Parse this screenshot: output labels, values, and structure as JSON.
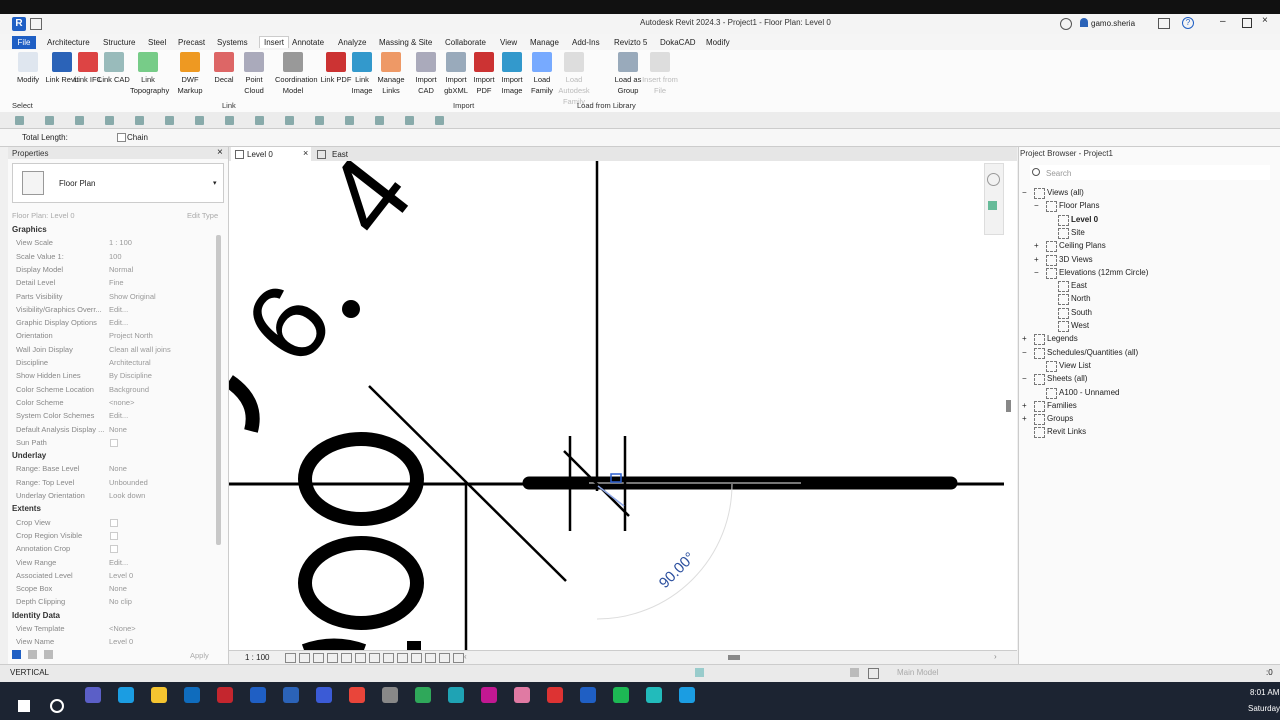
{
  "title_bar": {
    "title": "Autodesk Revit 2024.3 - Project1 - Floor Plan: Level 0",
    "user": "gamo.sheria",
    "logo_letter": "R"
  },
  "menu_tabs": [
    "File",
    "Architecture",
    "Structure",
    "Steel",
    "Precast",
    "Systems",
    "Insert",
    "Annotate",
    "Analyze",
    "Massing & Site",
    "Collaborate",
    "View",
    "Manage",
    "Add-Ins",
    "Revizto 5",
    "DokaCAD",
    "Modify"
  ],
  "active_tab": "Insert",
  "ribbon": {
    "buttons": [
      {
        "label": "Modify",
        "color": "#dfe6ef"
      },
      {
        "label": "Link Revit",
        "color": "#2b63b8"
      },
      {
        "label": "Link IFC",
        "color": "#d44"
      },
      {
        "label": "Link CAD",
        "color": "#9bb"
      },
      {
        "label": "Link Topography",
        "color": "#7c8"
      },
      {
        "label": "DWF Markup",
        "color": "#e92"
      },
      {
        "label": "Decal",
        "color": "#d66"
      },
      {
        "label": "Point Cloud",
        "color": "#aab"
      },
      {
        "label": "Coordination Model",
        "color": "#999"
      },
      {
        "label": "Link PDF",
        "color": "#c33"
      },
      {
        "label": "Link Image",
        "color": "#39c"
      },
      {
        "label": "Manage Links",
        "color": "#e96"
      },
      {
        "label": "Import CAD",
        "color": "#aab"
      },
      {
        "label": "Import gbXML",
        "color": "#9ab"
      },
      {
        "label": "Import PDF",
        "color": "#c33"
      },
      {
        "label": "Import Image",
        "color": "#39c"
      },
      {
        "label": "Load Family",
        "color": "#7af"
      },
      {
        "label": "Load Autodesk Family",
        "color": "#ddd"
      },
      {
        "label": "Load as Group",
        "color": "#9ab"
      },
      {
        "label": "Insert from File",
        "color": "#ddd"
      }
    ],
    "groups": {
      "select": "Select",
      "link": "Link",
      "import": "Import",
      "library": "Load from Library"
    }
  },
  "options_bar": {
    "total_length": "Total Length:",
    "chain": "Chain"
  },
  "properties": {
    "header": "Properties",
    "type_name": "Floor Plan",
    "instance": "Floor Plan: Level 0",
    "edit_type": "Edit Type",
    "sections": [
      {
        "title": "Graphics",
        "rows": [
          [
            "View Scale",
            "1 : 100"
          ],
          [
            "Scale Value    1:",
            "100"
          ],
          [
            "Display Model",
            "Normal"
          ],
          [
            "Detail Level",
            "Fine"
          ],
          [
            "Parts Visibility",
            "Show Original"
          ],
          [
            "Visibility/Graphics Overr...",
            "Edit..."
          ],
          [
            "Graphic Display Options",
            "Edit..."
          ],
          [
            "Orientation",
            "Project North"
          ],
          [
            "Wall Join Display",
            "Clean all wall joins"
          ],
          [
            "Discipline",
            "Architectural"
          ],
          [
            "Show Hidden Lines",
            "By Discipline"
          ],
          [
            "Color Scheme Location",
            "Background"
          ],
          [
            "Color Scheme",
            "<none>"
          ],
          [
            "System Color Schemes",
            "Edit..."
          ],
          [
            "Default Analysis Display ...",
            "None"
          ],
          [
            "Sun Path",
            ""
          ]
        ]
      },
      {
        "title": "Underlay",
        "rows": [
          [
            "Range: Base Level",
            "None"
          ],
          [
            "Range: Top Level",
            "Unbounded"
          ],
          [
            "Underlay Orientation",
            "Look down"
          ]
        ]
      },
      {
        "title": "Extents",
        "rows": [
          [
            "Crop View",
            ""
          ],
          [
            "Crop Region Visible",
            ""
          ],
          [
            "Annotation Crop",
            ""
          ],
          [
            "View Range",
            "Edit..."
          ],
          [
            "Associated Level",
            "Level 0"
          ],
          [
            "Scope Box",
            "None"
          ],
          [
            "Depth Clipping",
            "No clip"
          ]
        ]
      },
      {
        "title": "Identity Data",
        "rows": [
          [
            "View Template",
            "<None>"
          ],
          [
            "View Name",
            "Level 0"
          ]
        ]
      }
    ],
    "apply": "Apply"
  },
  "view_tabs": [
    "Level 0",
    "East"
  ],
  "canvas": {
    "dimension_digits": [
      "4",
      "6",
      "0",
      "0"
    ],
    "angle_label": "90.00°"
  },
  "view_control": {
    "scale": "1 : 100"
  },
  "project_browser": {
    "header": "Project Browser - Project1",
    "search_placeholder": "Search",
    "items": [
      {
        "label": "Views (all)",
        "depth": 0,
        "toggle": "−"
      },
      {
        "label": "Floor Plans",
        "depth": 1,
        "toggle": "−"
      },
      {
        "label": "Level 0",
        "depth": 2,
        "toggle": ""
      },
      {
        "label": "Site",
        "depth": 2,
        "toggle": ""
      },
      {
        "label": "Ceiling Plans",
        "depth": 1,
        "toggle": "+"
      },
      {
        "label": "3D Views",
        "depth": 1,
        "toggle": "+"
      },
      {
        "label": "Elevations (12mm Circle)",
        "depth": 1,
        "toggle": "−"
      },
      {
        "label": "East",
        "depth": 2,
        "toggle": ""
      },
      {
        "label": "North",
        "depth": 2,
        "toggle": ""
      },
      {
        "label": "South",
        "depth": 2,
        "toggle": ""
      },
      {
        "label": "West",
        "depth": 2,
        "toggle": ""
      },
      {
        "label": "Legends",
        "depth": 0,
        "toggle": "+"
      },
      {
        "label": "Schedules/Quantities (all)",
        "depth": 0,
        "toggle": "−"
      },
      {
        "label": "View List",
        "depth": 1,
        "toggle": ""
      },
      {
        "label": "Sheets (all)",
        "depth": 0,
        "toggle": "−"
      },
      {
        "label": "A100 - Unnamed",
        "depth": 1,
        "toggle": ""
      },
      {
        "label": "Families",
        "depth": 0,
        "toggle": "+"
      },
      {
        "label": "Groups",
        "depth": 0,
        "toggle": "+"
      },
      {
        "label": "Revit Links",
        "depth": 0,
        "toggle": ""
      }
    ]
  },
  "status_bar": {
    "left": "VERTICAL",
    "model": "Main Model",
    "right_value": ":0"
  },
  "taskbar": {
    "time": "8:01 AM",
    "day": "Saturday"
  },
  "colors": {
    "accent": "#1f5fc4",
    "canvas": "#ffffff",
    "taskbar": "#1c2432"
  }
}
